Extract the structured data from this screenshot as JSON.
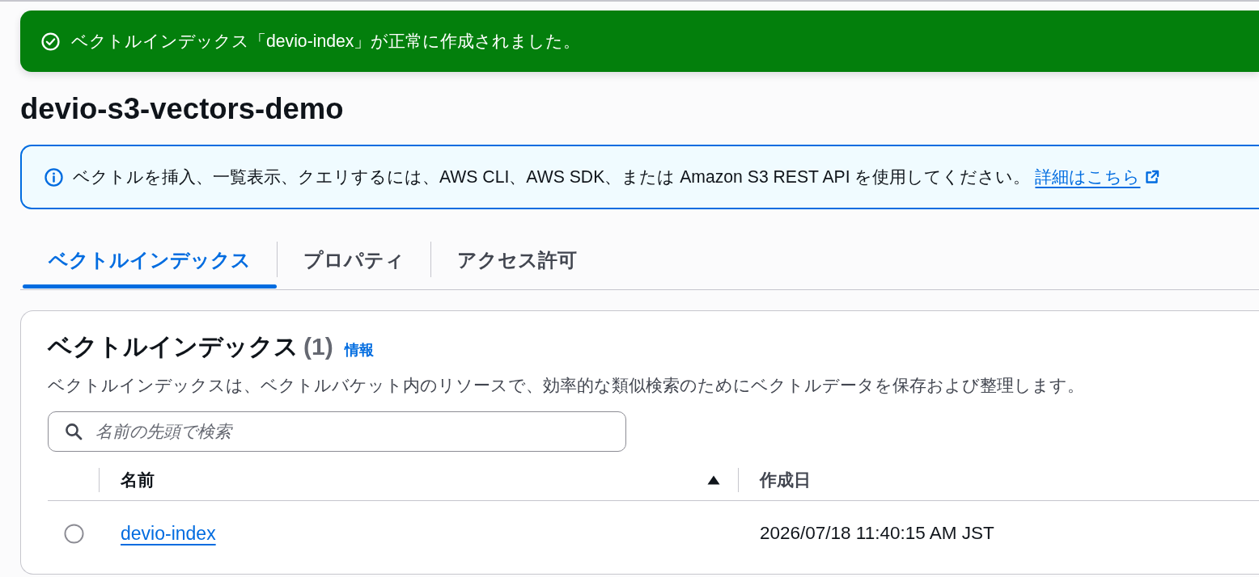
{
  "flash": {
    "kind": "success",
    "message": "ベクトルインデックス「devio-index」が正常に作成されました。"
  },
  "page_title": "devio-s3-vectors-demo",
  "info_alert": {
    "kind": "info",
    "message": "ベクトルを挿入、一覧表示、クエリするには、AWS CLI、AWS SDK、または Amazon S3 REST API を使用してください。",
    "link": "詳細はこちら"
  },
  "tabs": [
    {
      "label": "ベクトルインデックス",
      "selected": true
    },
    {
      "label": "プロパティ",
      "selected": false
    },
    {
      "label": "アクセス許可",
      "selected": false
    }
  ],
  "panel": {
    "title": "ベクトルインデックス",
    "count": "(1)",
    "info_link": "情報",
    "description": "ベクトルインデックスは、ベクトルバケット内のリソースで、効率的な類似検索のためにベクトルデータを保存および整理します。",
    "search": {
      "placeholder": "名前の先頭で検索"
    },
    "table": {
      "columns": [
        {
          "label": "名前",
          "sorted": true
        },
        {
          "label": "作成日",
          "sorted": false
        }
      ],
      "rows": [
        {
          "selected": false,
          "name": "devio-index",
          "created": "2026/07/18 11:40:15 AM JST"
        }
      ]
    }
  }
}
